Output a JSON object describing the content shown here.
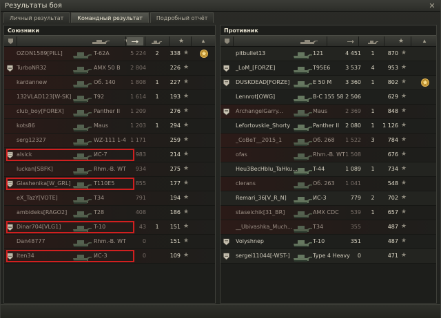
{
  "window": {
    "title": "Результаты боя"
  },
  "tabs": [
    {
      "label": "Личный результат",
      "active": false
    },
    {
      "label": "Командный результат",
      "active": true
    },
    {
      "label": "Подробный отчёт",
      "active": false
    }
  ],
  "allies": {
    "title": "Союзники",
    "rows": [
      {
        "name": "OZON1589[PILL]",
        "tank": "T-62A",
        "damage": "5 224",
        "kills": "2",
        "xp": "338",
        "dead": true,
        "clan": false,
        "medal": true,
        "highlight": false
      },
      {
        "name": "TurboNR32",
        "tank": "AMX 50 B",
        "damage": "2 804",
        "kills": "",
        "xp": "226",
        "dead": true,
        "clan": true,
        "medal": false,
        "highlight": false
      },
      {
        "name": "kardannew",
        "tank": "Об. 140",
        "damage": "1 808",
        "kills": "1",
        "xp": "227",
        "dead": true,
        "clan": false,
        "medal": false,
        "highlight": false
      },
      {
        "name": "132VLAD123[W-SK]",
        "tank": "T92",
        "damage": "1 614",
        "kills": "1",
        "xp": "193",
        "dead": true,
        "clan": false,
        "medal": false,
        "highlight": false
      },
      {
        "name": "club_boy[FOREX]",
        "tank": "Panther II",
        "damage": "1 209",
        "kills": "",
        "xp": "276",
        "dead": true,
        "clan": false,
        "medal": false,
        "highlight": false
      },
      {
        "name": "kots86",
        "tank": "Maus",
        "damage": "1 203",
        "kills": "1",
        "xp": "294",
        "dead": true,
        "clan": false,
        "medal": false,
        "highlight": false
      },
      {
        "name": "serg12327",
        "tank": "WZ-111 1-4",
        "damage": "1 171",
        "kills": "",
        "xp": "259",
        "dead": true,
        "clan": false,
        "medal": false,
        "highlight": false
      },
      {
        "name": "alsick",
        "tank": "ИС-7",
        "damage": "983",
        "kills": "",
        "xp": "214",
        "dead": true,
        "clan": true,
        "medal": false,
        "highlight": true
      },
      {
        "name": "luckan[SBFK]",
        "tank": "Rhm.-B. WT",
        "damage": "934",
        "kills": "",
        "xp": "275",
        "dead": true,
        "clan": false,
        "medal": false,
        "highlight": false
      },
      {
        "name": "Glashenika[W_GRL]",
        "tank": "T110E5",
        "damage": "855",
        "kills": "",
        "xp": "177",
        "dead": true,
        "clan": true,
        "medal": false,
        "highlight": true
      },
      {
        "name": "eX_TazY[VOTE]",
        "tank": "T34",
        "damage": "791",
        "kills": "",
        "xp": "194",
        "dead": true,
        "clan": false,
        "medal": false,
        "highlight": false
      },
      {
        "name": "ambideks[RAGO2]",
        "tank": "T28",
        "damage": "408",
        "kills": "",
        "xp": "186",
        "dead": true,
        "clan": false,
        "medal": false,
        "highlight": false
      },
      {
        "name": "Dinar704[VLG1]",
        "tank": "T-10",
        "damage": "43",
        "kills": "1",
        "xp": "151",
        "dead": true,
        "clan": true,
        "medal": false,
        "highlight": true
      },
      {
        "name": "Dan48777",
        "tank": "Rhm.-B. WT",
        "damage": "0",
        "kills": "",
        "xp": "151",
        "dead": true,
        "clan": false,
        "medal": false,
        "highlight": false
      },
      {
        "name": "Iten34",
        "tank": "ИС-3",
        "damage": "0",
        "kills": "",
        "xp": "109",
        "dead": true,
        "clan": true,
        "medal": false,
        "highlight": true
      }
    ]
  },
  "enemies": {
    "title": "Противник",
    "rows": [
      {
        "name": "pitbullet13",
        "tank": "121",
        "damage": "4 451",
        "kills": "1",
        "xp": "870",
        "dead": false,
        "clan": false,
        "medal": false
      },
      {
        "name": "_LoM_[FORZE]",
        "tank": "T95E6",
        "damage": "3 537",
        "kills": "4",
        "xp": "953",
        "dead": false,
        "clan": true,
        "medal": false
      },
      {
        "name": "DUSKDEAD[FORZE]",
        "tank": "E 50 M",
        "damage": "3 360",
        "kills": "1",
        "xp": "802",
        "dead": false,
        "clan": true,
        "medal": true
      },
      {
        "name": "Lennrot[OWG]",
        "tank": "В-С 155 58",
        "damage": "2 506",
        "kills": "",
        "xp": "629",
        "dead": false,
        "clan": false,
        "medal": false
      },
      {
        "name": "ArchangelGarry...",
        "tank": "Maus",
        "damage": "2 369",
        "kills": "1",
        "xp": "848",
        "dead": true,
        "clan": true,
        "medal": false
      },
      {
        "name": "Lefortovskie_Shorty",
        "tank": "Panther II",
        "damage": "2 080",
        "kills": "1",
        "xp": "1 126",
        "dead": false,
        "clan": false,
        "medal": false
      },
      {
        "name": "_CoBeT__2015_1",
        "tank": "Об. 268",
        "damage": "1 522",
        "kills": "3",
        "xp": "784",
        "dead": true,
        "clan": false,
        "medal": false
      },
      {
        "name": "ofas",
        "tank": "Rhm.-B. WT",
        "damage": "1 508",
        "kills": "",
        "xp": "676",
        "dead": true,
        "clan": false,
        "medal": false
      },
      {
        "name": "Heu3BecHblu_TaHku...",
        "tank": "T-44",
        "damage": "1 089",
        "kills": "1",
        "xp": "734",
        "dead": false,
        "clan": false,
        "medal": false
      },
      {
        "name": "clerans",
        "tank": "Об. 263",
        "damage": "1 041",
        "kills": "",
        "xp": "548",
        "dead": true,
        "clan": false,
        "medal": false
      },
      {
        "name": "Remari_36[V_R_N]",
        "tank": "ИС-3",
        "damage": "779",
        "kills": "2",
        "xp": "702",
        "dead": false,
        "clan": false,
        "medal": false
      },
      {
        "name": "staseichik[31_BR]",
        "tank": "AMX CDC",
        "damage": "539",
        "kills": "1",
        "xp": "657",
        "dead": true,
        "clan": false,
        "medal": false
      },
      {
        "name": "__Ubivashka_Much...",
        "tank": "T34",
        "damage": "355",
        "kills": "",
        "xp": "487",
        "dead": true,
        "clan": false,
        "medal": false
      },
      {
        "name": "Volyshnep",
        "tank": "T-10",
        "damage": "351",
        "kills": "",
        "xp": "487",
        "dead": false,
        "clan": true,
        "medal": false
      },
      {
        "name": "sergei11044[-WST-]",
        "tank": "Type 4 Heavy",
        "damage": "0",
        "kills": "",
        "xp": "471",
        "dead": false,
        "clan": true,
        "medal": false
      }
    ]
  },
  "colors": {
    "highlight": "#d21f1f",
    "dead_row": "#2c1b18"
  }
}
